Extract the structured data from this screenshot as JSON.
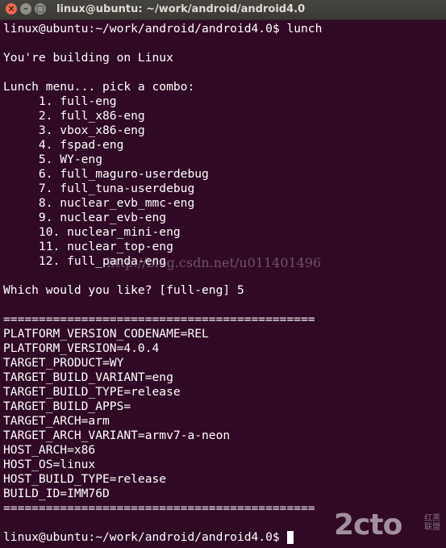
{
  "window": {
    "title": "linux@ubuntu: ~/work/android/android4.0",
    "close_glyph": "×",
    "minimize_glyph": "–",
    "maximize_glyph": "□"
  },
  "terminal": {
    "lines": [
      "linux@ubuntu:~/work/android/android4.0$ lunch",
      "",
      "You're building on Linux",
      "",
      "Lunch menu... pick a combo:",
      "     1. full-eng",
      "     2. full_x86-eng",
      "     3. vbox_x86-eng",
      "     4. fspad-eng",
      "     5. WY-eng",
      "     6. full_maguro-userdebug",
      "     7. full_tuna-userdebug",
      "     8. nuclear_evb_mmc-eng",
      "     9. nuclear_evb-eng",
      "     10. nuclear_mini-eng",
      "     11. nuclear_top-eng",
      "     12. full_panda-eng",
      "",
      "Which would you like? [full-eng] 5",
      "",
      "============================================",
      "PLATFORM_VERSION_CODENAME=REL",
      "PLATFORM_VERSION=4.0.4",
      "TARGET_PRODUCT=WY",
      "TARGET_BUILD_VARIANT=eng",
      "TARGET_BUILD_TYPE=release",
      "TARGET_BUILD_APPS=",
      "TARGET_ARCH=arm",
      "TARGET_ARCH_VARIANT=armv7-a-neon",
      "HOST_ARCH=x86",
      "HOST_OS=linux",
      "HOST_BUILD_TYPE=release",
      "BUILD_ID=IMM76D",
      "============================================",
      "",
      "linux@ubuntu:~/work/android/android4.0$ "
    ]
  },
  "watermark": {
    "url": "http://blog.csdn.net/u011401496",
    "logo": "2cto",
    "logo_sub": "红黑联盟"
  },
  "colors": {
    "background": "#300a24",
    "text": "#ffffff",
    "titlebar": "#3c3b37",
    "close_button": "#f4684a"
  }
}
